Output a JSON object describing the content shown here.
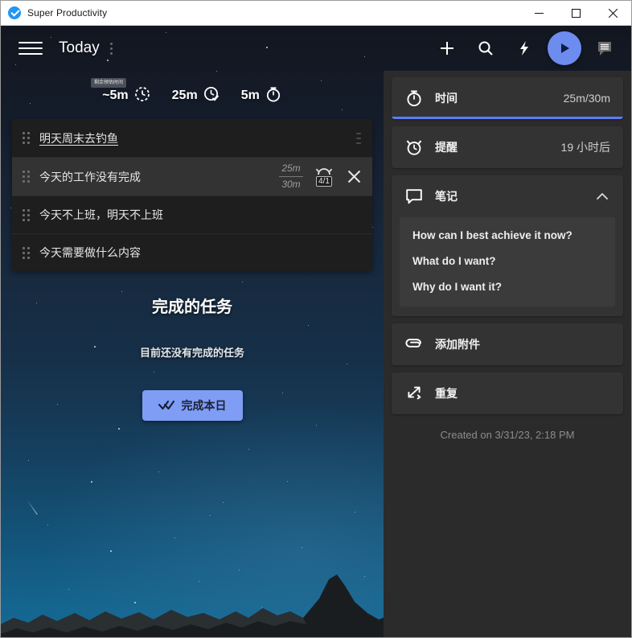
{
  "window": {
    "title": "Super Productivity",
    "app_icon": "check-circle-icon",
    "controls": {
      "minimize": "minimize-icon",
      "maximize": "maximize-icon",
      "close": "close-icon"
    }
  },
  "toolbar": {
    "menu_icon": "hamburger-menu-icon",
    "title": "Today",
    "more_icon": "more-vertical-icon",
    "actions": [
      {
        "name": "add-task-button",
        "icon": "plus-icon"
      },
      {
        "name": "search-button",
        "icon": "search-icon"
      },
      {
        "name": "quick-action-button",
        "icon": "lightning-bolt-icon"
      },
      {
        "name": "play-timer-button",
        "icon": "play-icon"
      },
      {
        "name": "notes-toggle-button",
        "icon": "note-icon"
      }
    ]
  },
  "summary": {
    "tooltip": "剩余预估时间",
    "items": [
      {
        "value": "~5m",
        "icon": "clock-dashed-icon"
      },
      {
        "value": "25m",
        "icon": "clock-check-icon"
      },
      {
        "value": "5m",
        "icon": "stopwatch-icon"
      }
    ]
  },
  "tasks": [
    {
      "title": "明天周末去钓鱼",
      "selected": false,
      "underline": true,
      "time_spent": "",
      "time_estimate": "",
      "alarm": "",
      "show_close": false,
      "show_vdots": true
    },
    {
      "title": "今天的工作没有完成",
      "selected": true,
      "underline": false,
      "time_spent": "25m",
      "time_estimate": "30m",
      "alarm": "4/1",
      "show_close": true,
      "show_vdots": false
    },
    {
      "title": "今天不上班，明天不上班",
      "selected": false,
      "underline": false,
      "time_spent": "",
      "time_estimate": "",
      "alarm": "",
      "show_close": false,
      "show_vdots": false
    },
    {
      "title": "今天需要做什么内容",
      "selected": false,
      "underline": false,
      "time_spent": "",
      "time_estimate": "",
      "alarm": "",
      "show_close": false,
      "show_vdots": false
    }
  ],
  "done_section": {
    "title": "完成的任务",
    "empty_text": "目前还没有完成的任务",
    "finish_button": "完成本日",
    "finish_icon": "double-check-icon"
  },
  "side_panel": {
    "time": {
      "label": "时间",
      "value": "25m/30m",
      "icon": "stopwatch-icon",
      "accent": "#5c7cfa"
    },
    "reminder": {
      "label": "提醒",
      "value": "19 小时后",
      "icon": "alarm-clock-icon"
    },
    "notes": {
      "label": "笔记",
      "icon": "comment-icon",
      "collapse_icon": "chevron-up-icon",
      "lines": [
        "How can I best achieve it now?",
        "What do I want?",
        "Why do I want it?"
      ]
    },
    "attachment": {
      "label": "添加附件",
      "icon": "paperclip-icon"
    },
    "repeat": {
      "label": "重复",
      "icon": "repeat-icon"
    },
    "created": "Created on 3/31/23, 2:18 PM"
  },
  "colors": {
    "accent": "#5c7cfa",
    "play_button": "#6d8cf0",
    "panel_bg": "#2b2b2b",
    "card_bg": "#333333",
    "task_bg": "#1e1e1e",
    "task_selected_bg": "#333333"
  }
}
